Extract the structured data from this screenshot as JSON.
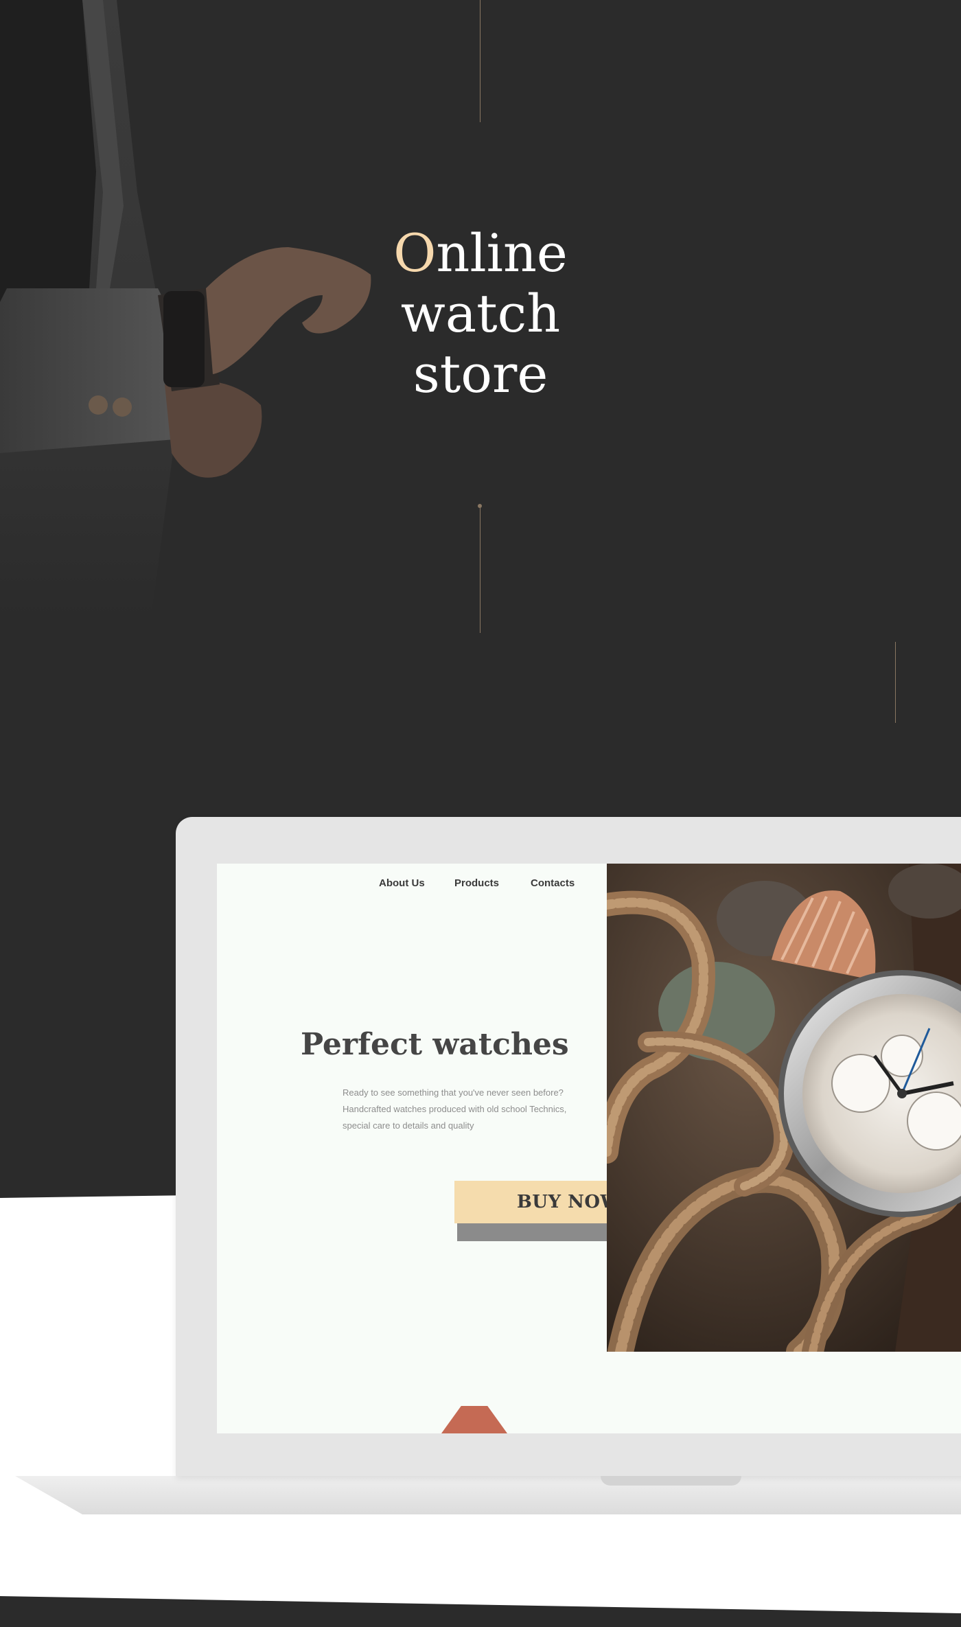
{
  "hero": {
    "title_first_letter": "O",
    "title_line1_rest": "nline",
    "title_line2": "watch",
    "title_line3": "store"
  },
  "site": {
    "nav": [
      "About Us",
      "Products",
      "Contacts"
    ],
    "heading": "Perfect watches",
    "description": "Ready to see something that you've never seen before? Handcrafted watches produced with old school Technics, special care to details and quality",
    "cta": "BUY NOW"
  },
  "colors": {
    "background_dark": "#2b2b2b",
    "accent": "#f6d8ad",
    "button": "#f5dcad",
    "screen_bg": "#f8fcf8",
    "line": "#8a7762"
  }
}
